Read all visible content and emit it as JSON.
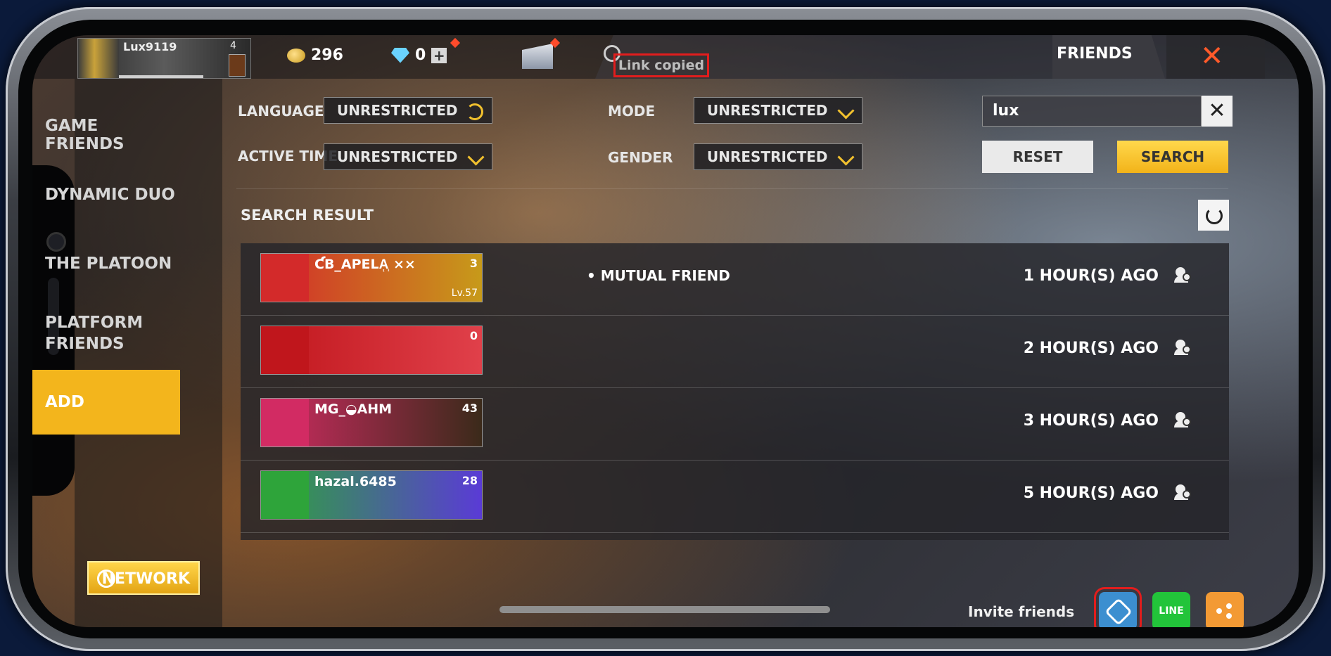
{
  "header": {
    "player_name": "Lux9119",
    "player_level": "4",
    "coins": "296",
    "diamonds": "0",
    "toast": "Link copied",
    "title": "FRIENDS"
  },
  "sidebar": {
    "items": [
      {
        "label": "GAME FRIENDS"
      },
      {
        "label": "DYNAMIC DUO"
      },
      {
        "label": "THE PLATOON"
      },
      {
        "label": "PLATFORM FRIENDS"
      },
      {
        "label": "ADD"
      }
    ],
    "network_label": "NETWORK"
  },
  "filters": {
    "language_label": "LANGUAGE",
    "language_value": "UNRESTRICTED",
    "active_time_label": "ACTIVE TIME",
    "active_time_value": "UNRESTRICTED",
    "mode_label": "MODE",
    "mode_value": "UNRESTRICTED",
    "gender_label": "GENDER",
    "gender_value": "UNRESTRICTED"
  },
  "search": {
    "query": "lux",
    "reset_label": "RESET",
    "search_label": "SEARCH"
  },
  "results": {
    "title": "SEARCH RESULT",
    "rows": [
      {
        "name": "ƇB_APELA᷂᷂ ××",
        "level": "3",
        "sub": "Lv.57",
        "tag": "• MUTUAL FRIEND",
        "time": "1 HOUR(S) AGO",
        "colors": [
          "#d32a2a",
          "#c79a1a"
        ]
      },
      {
        "name": "",
        "level": "0",
        "sub": "",
        "tag": "",
        "time": "2 HOUR(S) AGO",
        "colors": [
          "#c0161c",
          "#e0404a"
        ]
      },
      {
        "name": "MG_◒AHM",
        "level": "43",
        "sub": "",
        "tag": "",
        "time": "3 HOUR(S) AGO",
        "colors": [
          "#d22b63",
          "#3b2a1a"
        ]
      },
      {
        "name": "hazal.6485",
        "level": "28",
        "sub": "",
        "tag": "",
        "time": "5 HOUR(S) AGO",
        "colors": [
          "#2ea43a",
          "#5a3bd6"
        ]
      }
    ]
  },
  "invite": {
    "label": "Invite friends",
    "line_label": "LINE"
  }
}
